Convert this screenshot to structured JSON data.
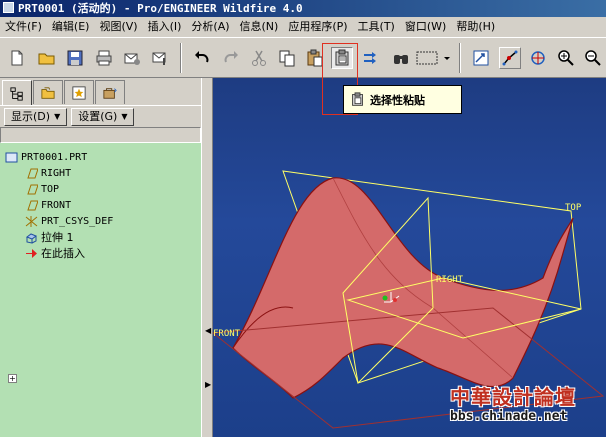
{
  "window": {
    "title": "PRT0001 (活动的) - Pro/ENGINEER Wildfire 4.0"
  },
  "menu": [
    {
      "label": "文件(F)"
    },
    {
      "label": "编辑(E)"
    },
    {
      "label": "视图(V)"
    },
    {
      "label": "插入(I)"
    },
    {
      "label": "分析(A)"
    },
    {
      "label": "信息(N)"
    },
    {
      "label": "应用程序(P)"
    },
    {
      "label": "工具(T)"
    },
    {
      "label": "窗口(W)"
    },
    {
      "label": "帮助(H)"
    }
  ],
  "toolbar": {
    "tooltip": "选择性粘贴"
  },
  "panel": {
    "show_label": "显示(D)",
    "settings_label": "设置(G)"
  },
  "tree": [
    {
      "label": "PRT0001.PRT",
      "icon": "part-icon"
    },
    {
      "label": "RIGHT",
      "icon": "datum-plane-icon"
    },
    {
      "label": "TOP",
      "icon": "datum-plane-icon"
    },
    {
      "label": "FRONT",
      "icon": "datum-plane-icon"
    },
    {
      "label": "PRT_CSYS_DEF",
      "icon": "csys-icon"
    },
    {
      "label": "拉伸 1",
      "icon": "extrude-icon"
    },
    {
      "label": "在此插入",
      "icon": "insert-arrow-icon"
    }
  ],
  "viewport": {
    "labels": {
      "top": "TOP",
      "right": "RIGHT",
      "front": "FRONT"
    },
    "colors": {
      "surface": "#d46a6a",
      "datum": "#ffff66",
      "background": "#1e3c82"
    }
  },
  "watermark": {
    "title": "中華設計論壇",
    "url": "bbs.chinade.net"
  }
}
